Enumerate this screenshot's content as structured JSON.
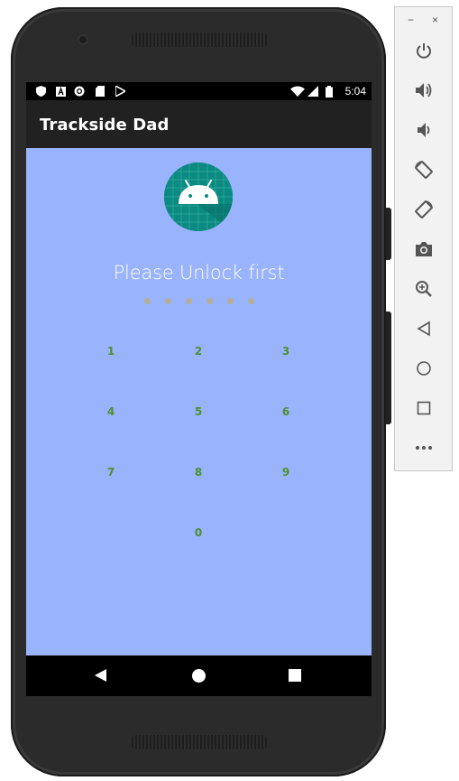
{
  "app": {
    "title": "Trackside Dad",
    "prompt": "Please Unlock first",
    "pin_length": 6
  },
  "status_bar": {
    "time": "5:04",
    "left_icons": [
      "shield-icon",
      "a-icon",
      "circle-icon",
      "sd-card-icon",
      "play-store-icon"
    ],
    "right_icons": [
      "wifi-icon",
      "signal-icon",
      "battery-icon"
    ]
  },
  "keypad": {
    "keys": [
      "1",
      "2",
      "3",
      "4",
      "5",
      "6",
      "7",
      "8",
      "9",
      "0"
    ]
  },
  "navigation": {
    "buttons": [
      "back-icon",
      "home-icon",
      "recents-icon"
    ]
  },
  "emulator_toolbar": {
    "minimize_label": "−",
    "close_label": "×",
    "buttons": [
      "power-icon",
      "volume-up-icon",
      "volume-down-icon",
      "rotate-left-icon",
      "rotate-right-icon",
      "camera-icon",
      "zoom-icon",
      "back-icon",
      "home-icon",
      "overview-icon",
      "more-icon"
    ]
  },
  "colors": {
    "content_bg": "#99b3fd",
    "appbar_bg": "#212121",
    "key_text": "#4f8f2e",
    "dot": "#b4ae9a",
    "icon_teal": "#0a8a80"
  }
}
